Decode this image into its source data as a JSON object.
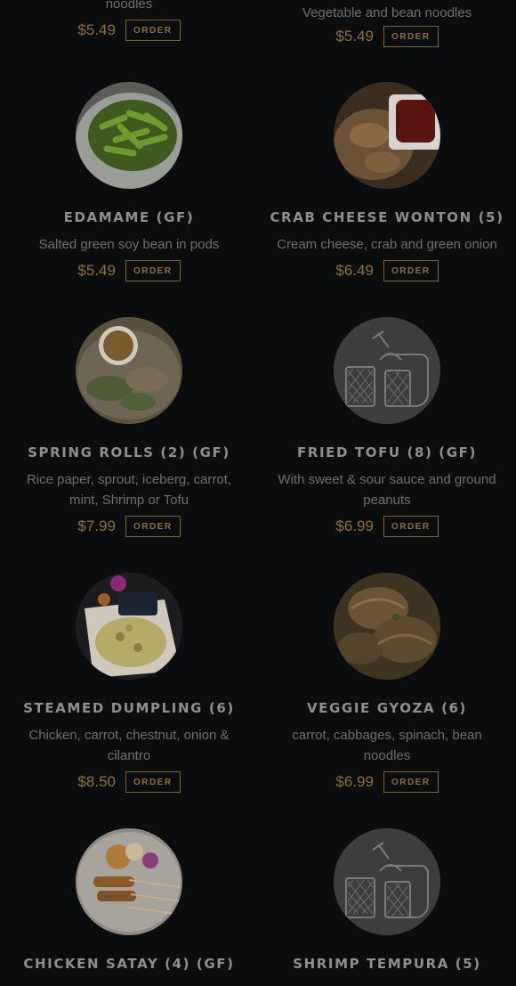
{
  "items": [
    {
      "name": "",
      "desc": "noodles",
      "price": "$5.49",
      "order": "ORDER",
      "image": "placeholder-top"
    },
    {
      "name": "",
      "desc": "Vegetable and bean noodles",
      "price": "$5.49",
      "order": "ORDER",
      "image": "placeholder-top"
    },
    {
      "name": "EDAMAME (GF)",
      "desc": "Salted green soy bean in pods",
      "price": "$5.49",
      "order": "ORDER",
      "image": "edamame-photo"
    },
    {
      "name": "CRAB CHEESE WONTON (5)",
      "desc": "Cream cheese, crab and green onion",
      "price": "$6.49",
      "order": "ORDER",
      "image": "wonton-photo"
    },
    {
      "name": "SPRING ROLLS (2) (GF)",
      "desc": "Rice paper, sprout, iceberg, carrot, mint, Shrimp or Tofu",
      "price": "$7.99",
      "order": "ORDER",
      "image": "spring-rolls-photo"
    },
    {
      "name": "FRIED TOFU (8) (GF)",
      "desc": "With sweet & sour sauce and ground peanuts",
      "price": "$6.99",
      "order": "ORDER",
      "image": "placeholder-icon"
    },
    {
      "name": "STEAMED DUMPLING (6)",
      "desc": "Chicken, carrot, chestnut, onion & cilantro",
      "price": "$8.50",
      "order": "ORDER",
      "image": "dumpling-photo"
    },
    {
      "name": "VEGGIE GYOZA (6)",
      "desc": "carrot, cabbages, spinach, bean noodles",
      "price": "$6.99",
      "order": "ORDER",
      "image": "gyoza-photo"
    },
    {
      "name": "CHICKEN SATAY (4) (GF)",
      "desc": "",
      "price": "",
      "order": "",
      "image": "satay-photo"
    },
    {
      "name": "SHRIMP TEMPURA (5)",
      "desc": "",
      "price": "",
      "order": "",
      "image": "placeholder-icon"
    }
  ],
  "colors": {
    "background": "#0b0c0e",
    "price": "#8c6f3a",
    "title": "#8f8f8f",
    "desc": "#6e6e6e"
  }
}
